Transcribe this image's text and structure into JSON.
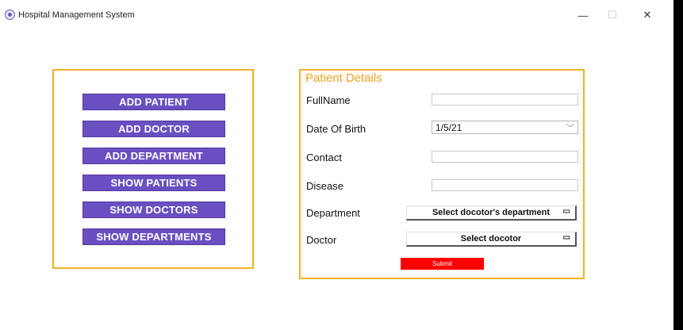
{
  "window": {
    "title": "Hospital Management System",
    "app_icon": "hospital-logo-icon",
    "minimize_glyph": "—",
    "maximize_glyph": "☐",
    "close_glyph": "✕"
  },
  "menu": {
    "buttons": [
      "ADD PATIENT",
      "ADD DOCTOR",
      "ADD DEPARTMENT",
      "SHOW PATIENTS",
      "SHOW DOCTORS",
      "SHOW DEPARTMENTS"
    ],
    "button_color": "#6a4fc2",
    "border_color": "#f4b223"
  },
  "form": {
    "title": "Patient Details",
    "fullname_label": "FullName",
    "fullname_value": "",
    "dob_label": "Date Of Birth",
    "dob_value": "1/5/21",
    "contact_label": "Contact",
    "contact_value": "",
    "disease_label": "Disease",
    "disease_value": "",
    "department_label": "Department",
    "department_selected": "Select docotor's department",
    "doctor_label": "Doctor",
    "doctor_selected": "Select docotor",
    "submit_label": "Submit",
    "submit_color": "#ff0000",
    "title_color": "#f4a21e"
  }
}
